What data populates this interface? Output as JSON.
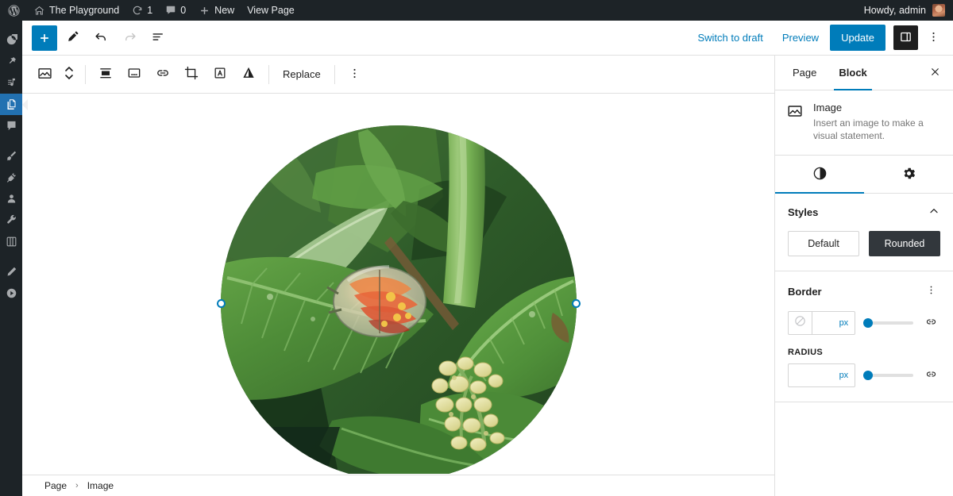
{
  "adminbar": {
    "logo_icon": "wordpress-logo-icon",
    "site_icon": "home-icon",
    "site_name": "The Playground",
    "updates_icon": "updates-icon",
    "updates_count": "1",
    "comments_icon": "comment-bubble-icon",
    "comments_count": "0",
    "new_icon": "plus-icon",
    "new_label": "New",
    "view_page_label": "View Page",
    "howdy": "Howdy, admin",
    "avatar_name": "user-avatar"
  },
  "adminmenu": {
    "items": [
      {
        "name": "dashboard",
        "icon": "dashboard-icon",
        "active": false
      },
      {
        "name": "posts",
        "icon": "pin-icon",
        "active": false
      },
      {
        "name": "media",
        "icon": "media-icon",
        "active": false
      },
      {
        "name": "pages",
        "icon": "pages-icon",
        "active": true
      },
      {
        "name": "comments",
        "icon": "comment-icon",
        "active": false
      },
      {
        "name": "appearance",
        "icon": "paintbrush-icon",
        "active": false
      },
      {
        "name": "plugins",
        "icon": "plug-icon",
        "active": false
      },
      {
        "name": "users",
        "icon": "user-icon",
        "active": false
      },
      {
        "name": "tools",
        "icon": "wrench-icon",
        "active": false
      },
      {
        "name": "settings",
        "icon": "settings-sliders-icon",
        "active": false
      },
      {
        "name": "editor",
        "icon": "pencil-icon",
        "active": false
      },
      {
        "name": "player",
        "icon": "play-circle-icon",
        "active": false
      }
    ]
  },
  "header": {
    "inserter_label": "+",
    "inserter_name": "add-block-button",
    "tools_icon": "pencil-tools-icon",
    "undo_icon": "undo-icon",
    "redo_icon": "redo-icon",
    "listview_icon": "list-view-icon",
    "switch_to_draft": "Switch to draft",
    "preview": "Preview",
    "update": "Update",
    "sidebar_toggle_icon": "settings-panel-icon",
    "options_icon": "kebab-menu-icon"
  },
  "blocktoolbar": {
    "block_type_icon": "image-block-icon",
    "mover_icon": "move-up-down-icon",
    "align_icon": "align-icon",
    "caption_icon": "caption-icon",
    "link_icon": "link-icon",
    "crop_icon": "crop-icon",
    "text_over_image_icon": "text-over-image-icon",
    "duotone_icon": "duotone-filter-icon",
    "replace_label": "Replace",
    "more_icon": "kebab-menu-icon"
  },
  "canvas": {
    "image_name": "leaf-beetle-photo",
    "image_alt": "Circular photograph of green leaves with an orange tortoise beetle and cream colored flower buds",
    "handles": [
      "left-resize-handle",
      "right-resize-handle",
      "bottom-resize-handle"
    ]
  },
  "footer": {
    "breadcrumb": [
      "Page",
      "Image"
    ],
    "separator": "›"
  },
  "sidebar": {
    "tabs": [
      {
        "label": "Page",
        "active": false
      },
      {
        "label": "Block",
        "active": true
      }
    ],
    "close_icon": "close-icon",
    "block_card": {
      "icon": "image-block-icon",
      "title": "Image",
      "description": "Insert an image to make a visual statement."
    },
    "panel_tabs": [
      {
        "name": "styles",
        "icon": "contrast-half-circle-icon",
        "active": true
      },
      {
        "name": "settings",
        "icon": "gear-icon",
        "active": false
      }
    ],
    "styles": {
      "title": "Styles",
      "collapse_icon": "chevron-up-icon",
      "options": [
        {
          "label": "Default",
          "selected": false
        },
        {
          "label": "Rounded",
          "selected": true
        }
      ]
    },
    "border": {
      "title": "Border",
      "more_icon": "kebab-menu-icon",
      "color_swatch_icon": "no-color-slash-icon",
      "unit": "px",
      "width_value": "",
      "slider_percent": "0",
      "link_icon": "unlink-icon",
      "radius_label": "RADIUS",
      "radius_unit": "px",
      "radius_value": "",
      "radius_slider_percent": "0",
      "radius_link_icon": "unlink-icon"
    }
  },
  "colors": {
    "wp_blue": "#007cba",
    "admin_blue": "#2271b1",
    "adminbar_bg": "#1d2327",
    "dark_button": "#32373c"
  }
}
